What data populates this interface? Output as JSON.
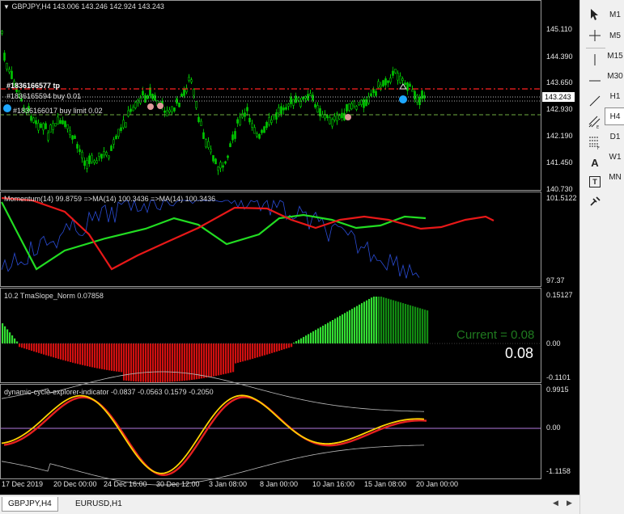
{
  "chart_header": {
    "title_text": "GBPJPY,H4  143.006 143.246 142.924 143.243"
  },
  "price_axis": [
    "145.110",
    "144.390",
    "143.650",
    "142.930",
    "142.190",
    "141.450",
    "140.730"
  ],
  "current_price": "143.243",
  "orders": [
    {
      "label": "#1836166577 tp",
      "color": "#ff3030"
    },
    {
      "label": "#1836165594 buy 0.01",
      "color": "#ffffff"
    },
    {
      "label": "#1836166017 buy limit 0.02",
      "color": "#ffffff"
    }
  ],
  "momentum": {
    "label": "Momentum(14) 99.8759  =>MA(14) 100.3436  =>MA(14) 100.3436",
    "axis_top": "101.5122",
    "axis_bottom": "97.37"
  },
  "tma": {
    "label": "10.2 TmaSlope_Norm 0.07858",
    "axis": [
      "0.15127",
      "0.00",
      "-0.1101"
    ],
    "current_text": "Current = 0.08",
    "big_value": "0.08"
  },
  "cycle": {
    "label": "dynamic-cycle-explorer-indicator -0.0837 -0.0563 0.1579 -0.2050",
    "axis": [
      "0.9915",
      "0.00",
      "-1.1158"
    ]
  },
  "time_axis": [
    "17 Dec 2019",
    "20 Dec 00:00",
    "24 Dec 16:00",
    "30 Dec 12:00",
    "3 Jan 08:00",
    "8 Jan 00:00",
    "10 Jan 16:00",
    "15 Jan 08:00",
    "20 Jan 00:00"
  ],
  "toolbar": {
    "timeframes": [
      "M1",
      "M5",
      "M15",
      "M30",
      "H1",
      "H4",
      "D1",
      "W1",
      "MN"
    ],
    "active_timeframe": "H4",
    "tools": [
      "cursor-icon",
      "crosshair-icon",
      "vertical-line-icon",
      "horizontal-line-icon",
      "trendline-icon",
      "fibonacci-icon",
      "channel-icon",
      "text-icon",
      "label-icon",
      "arrows-icon"
    ],
    "text_tool": "A",
    "label_tool": "T"
  },
  "tabs": [
    "GBPJPY,H4",
    "EURUSD,H1"
  ],
  "colors": {
    "bull": "#00c800",
    "bear": "#ff2020",
    "momentum_green": "#22dd22",
    "momentum_red": "#e81818",
    "tma_light_green": "#33dd33",
    "tma_dark_green": "#128a12",
    "tma_red": "#d01010",
    "cycle_yellow": "#ffd200",
    "cycle_red": "#e52020"
  }
}
